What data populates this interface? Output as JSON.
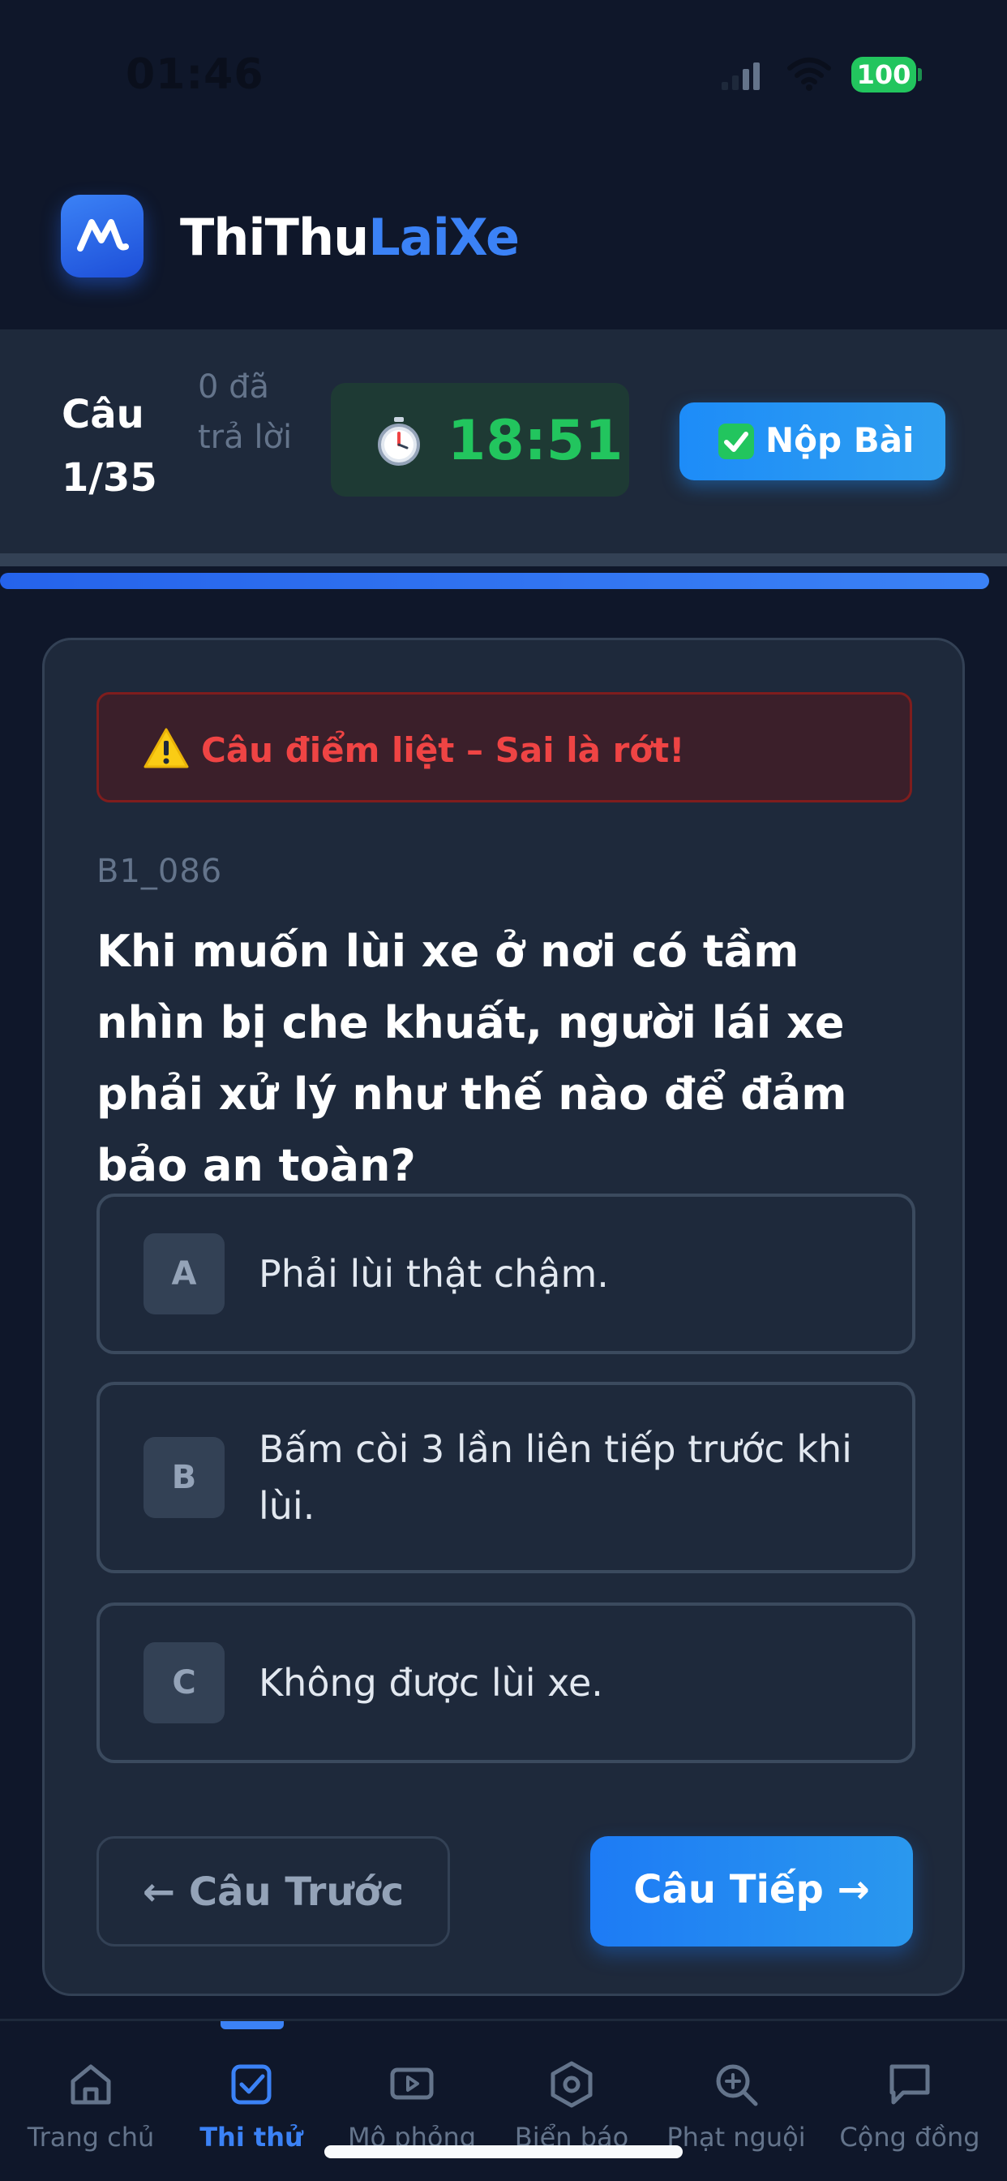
{
  "status_bar": {
    "time": "01:46",
    "battery": "100"
  },
  "header": {
    "brand_part1": "ThiThu",
    "brand_part2": "LaiXe"
  },
  "quiz_bar": {
    "question_label": "Câu 1/35",
    "answered_label": "0 đã trả lời",
    "timer": "18:51",
    "submit_label": "Nộp Bài"
  },
  "progress": {
    "fraction": 0.99
  },
  "question": {
    "warning": "Câu điểm liệt – Sai là rớt!",
    "code": "B1_086",
    "text": "Khi muốn lùi xe ở nơi có tầm nhìn bị che khuất, người lái xe phải xử lý như thế nào để đảm bảo an toàn?",
    "options": [
      {
        "letter": "A",
        "text": "Phải lùi thật chậm."
      },
      {
        "letter": "B",
        "text": "Bấm còi 3 lần liên tiếp trước khi lùi."
      },
      {
        "letter": "C",
        "text": "Không được lùi xe."
      }
    ],
    "prev_label": "← Câu Trước",
    "next_label": "Câu Tiếp →"
  },
  "bottom_nav": {
    "active": "Thi thử",
    "items": [
      {
        "label": "Trang chủ",
        "icon": "home-icon"
      },
      {
        "label": "Thi thử",
        "icon": "checkbox-icon"
      },
      {
        "label": "Mô phỏng",
        "icon": "play-icon"
      },
      {
        "label": "Biển báo",
        "icon": "hexagon-icon"
      },
      {
        "label": "Phạt nguội",
        "icon": "zoom-in-icon"
      },
      {
        "label": "Cộng đồng",
        "icon": "chat-icon"
      }
    ]
  },
  "colors": {
    "accent": "#3b82f6",
    "timer": "#22c55e",
    "danger": "#ef4444",
    "background": "#0f172a"
  }
}
